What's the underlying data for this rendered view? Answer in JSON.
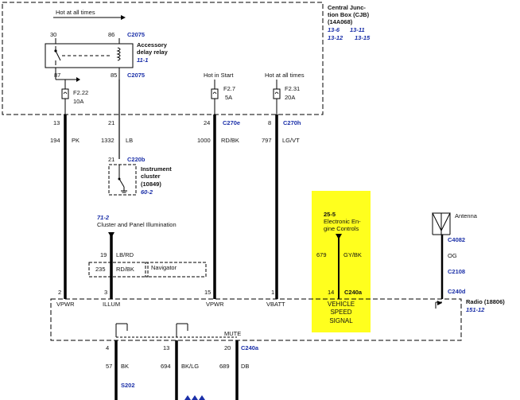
{
  "colors": {
    "highlight": "#ffff1e",
    "link_blue": "#1a2fa8",
    "wire": "#000000"
  },
  "cjb": {
    "title": "Central Junc-",
    "title2": "tion Box (CJB)",
    "part": "(14A068)",
    "refs": [
      "13-6",
      "13-11",
      "13-12",
      "13-15"
    ]
  },
  "relay": {
    "hot_label": "Hot at all times",
    "pin_top_left": "30",
    "pin_top_right": "86",
    "pin_bottom_left": "87",
    "pin_bottom_right": "85",
    "connector_top": "C2075",
    "connector_bottom": "C2075",
    "name": "Accessory",
    "name2": "delay relay",
    "ref": "11-1"
  },
  "fuses": [
    {
      "id": "F2.22",
      "amp": "10A"
    },
    {
      "id": "F2.7",
      "amp": "5A",
      "label": "Hot in Start"
    },
    {
      "id": "F2.31",
      "amp": "20A",
      "label": "Hot at all times"
    }
  ],
  "cjb_pins": [
    {
      "pin": "13",
      "circuit": "194",
      "color": "PK",
      "connector": ""
    },
    {
      "pin": "21",
      "circuit": "1332",
      "color": "LB",
      "connector": ""
    },
    {
      "pin": "24",
      "circuit": "1000",
      "color": "RD/BK",
      "connector": "C270e"
    },
    {
      "pin": "8",
      "circuit": "797",
      "color": "LG/VT",
      "connector": "C270h"
    }
  ],
  "cluster": {
    "pin": "21",
    "connector": "C220b",
    "name": "Instrument",
    "name2": "cluster",
    "part": "(10849)",
    "ref": "60-2"
  },
  "illumination": {
    "ref": "71-2",
    "label": "Cluster and Panel Illumination",
    "pin": "19",
    "wire": "LB/RD",
    "alt_pin": "235",
    "alt_wire": "RD/BK",
    "alt_label": "Navigator"
  },
  "vss": {
    "ref": "25-5",
    "label": "Electronic En-",
    "label2": "gine Controls",
    "circuit": "679",
    "color": "GY/BK",
    "pin": "14",
    "connector": "C240a",
    "signal": [
      "VEHICLE",
      "SPEED",
      "SIGNAL"
    ]
  },
  "antenna": {
    "label": "Antenna",
    "c1": "C4082",
    "wire": "OG",
    "c2": "C2108",
    "c3": "C240d"
  },
  "radio": {
    "name": "Radio (18806)",
    "ref": "151-12",
    "pins": [
      {
        "pin": "2",
        "label": "VPWR"
      },
      {
        "pin": "3",
        "label": "ILLUM"
      },
      {
        "pin": "15",
        "label": "VPWR"
      },
      {
        "pin": "1",
        "label": "VBATT"
      }
    ],
    "mute_label": "MUTE"
  },
  "bottom": {
    "pins": [
      {
        "pin": "4",
        "circuit": "57",
        "color": "BK"
      },
      {
        "pin": "13",
        "circuit": "694",
        "color": "BK/LG"
      },
      {
        "pin": "20",
        "circuit": "689",
        "color": "DB"
      }
    ],
    "connector": "C240a",
    "splice": "S202"
  }
}
